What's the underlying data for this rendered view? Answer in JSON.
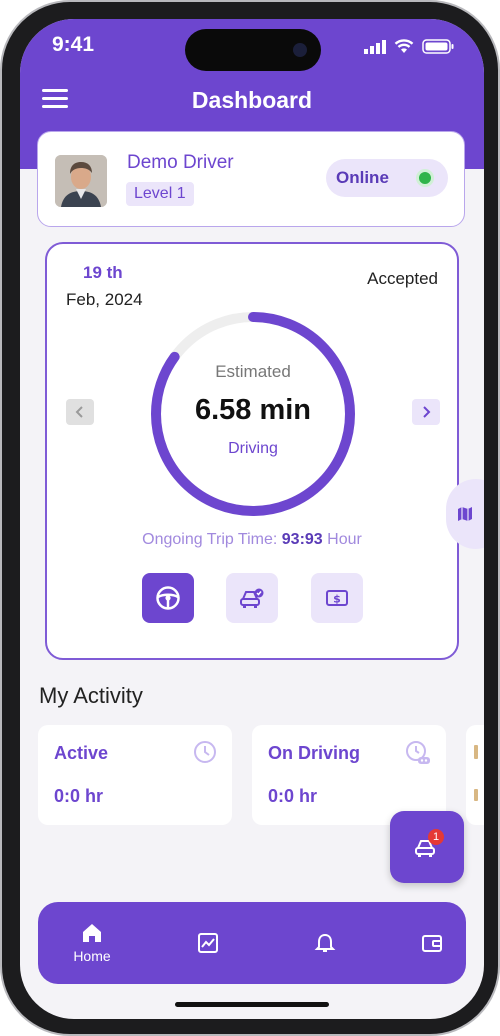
{
  "status_bar": {
    "time": "9:41"
  },
  "header": {
    "title": "Dashboard"
  },
  "driver": {
    "name": "Demo Driver",
    "level": "Level 1",
    "status_label": "Online"
  },
  "trip": {
    "date_day": "19 th",
    "date_month": "Feb, 2024",
    "status": "Accepted",
    "estimate_label": "Estimated",
    "estimate_value": "6.58 min",
    "mode": "Driving",
    "progress_fraction": 0.85,
    "ongoing_label": "Ongoing Trip Time:",
    "ongoing_value": "93:93",
    "ongoing_unit": "Hour"
  },
  "activity": {
    "title": "My Activity",
    "cards": [
      {
        "label": "Active",
        "value": "0:0 hr"
      },
      {
        "label": "On Driving",
        "value": "0:0 hr"
      }
    ]
  },
  "fab": {
    "badge_count": "1"
  },
  "bottom_nav": {
    "home_label": "Home"
  },
  "colors": {
    "accent": "#6d46cf",
    "accent_light": "#ebe5fa",
    "online": "#2fb44a",
    "badge": "#e53935"
  }
}
